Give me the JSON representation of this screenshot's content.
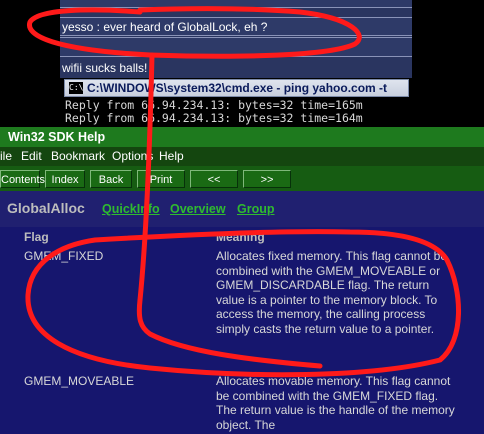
{
  "chat": {
    "message_1": "yesso : ever heard of GlobalLock, eh ?",
    "message_2": "wifii sucks balls!"
  },
  "cmd_window": {
    "icon_text": "C:\\",
    "title": "C:\\WINDOWS\\system32\\cmd.exe - ping yahoo.com -t",
    "lines": [
      "Reply from 66.94.234.13: bytes=32 time=165m",
      "Reply from 66.94.234.13: bytes=32 time=164m"
    ]
  },
  "help_window": {
    "title": "Win32 SDK Help",
    "menu": [
      "ile",
      "Edit",
      "Bookmark",
      "Options",
      "Help"
    ],
    "toolbar": [
      "Contents",
      "Index",
      "Back",
      "Print",
      "<<",
      ">>"
    ],
    "topic": "GlobalAlloc",
    "topic_links": [
      "QuickInfo",
      "Overview",
      "Group"
    ],
    "columns": {
      "flag": "Flag",
      "meaning": "Meaning"
    },
    "rows": [
      {
        "flag": "GMEM_FIXED",
        "meaning": "Allocates fixed memory. This flag cannot be combined with the GMEM_MOVEABLE or GMEM_DISCARDABLE flag. The return value is a pointer to the memory block. To access the memory, the calling process simply casts the return value to a pointer."
      },
      {
        "flag": "GMEM_MOVEABLE",
        "meaning": "Allocates movable memory. This flag cannot be combined with the GMEM_FIXED flag. The return value is the handle of the memory object. The"
      }
    ]
  },
  "colors": {
    "annotation": "#ff1a1a",
    "help_title_bar": "#1e7a1e",
    "help_background": "#1d1d7a",
    "link": "#2fbb2f"
  }
}
